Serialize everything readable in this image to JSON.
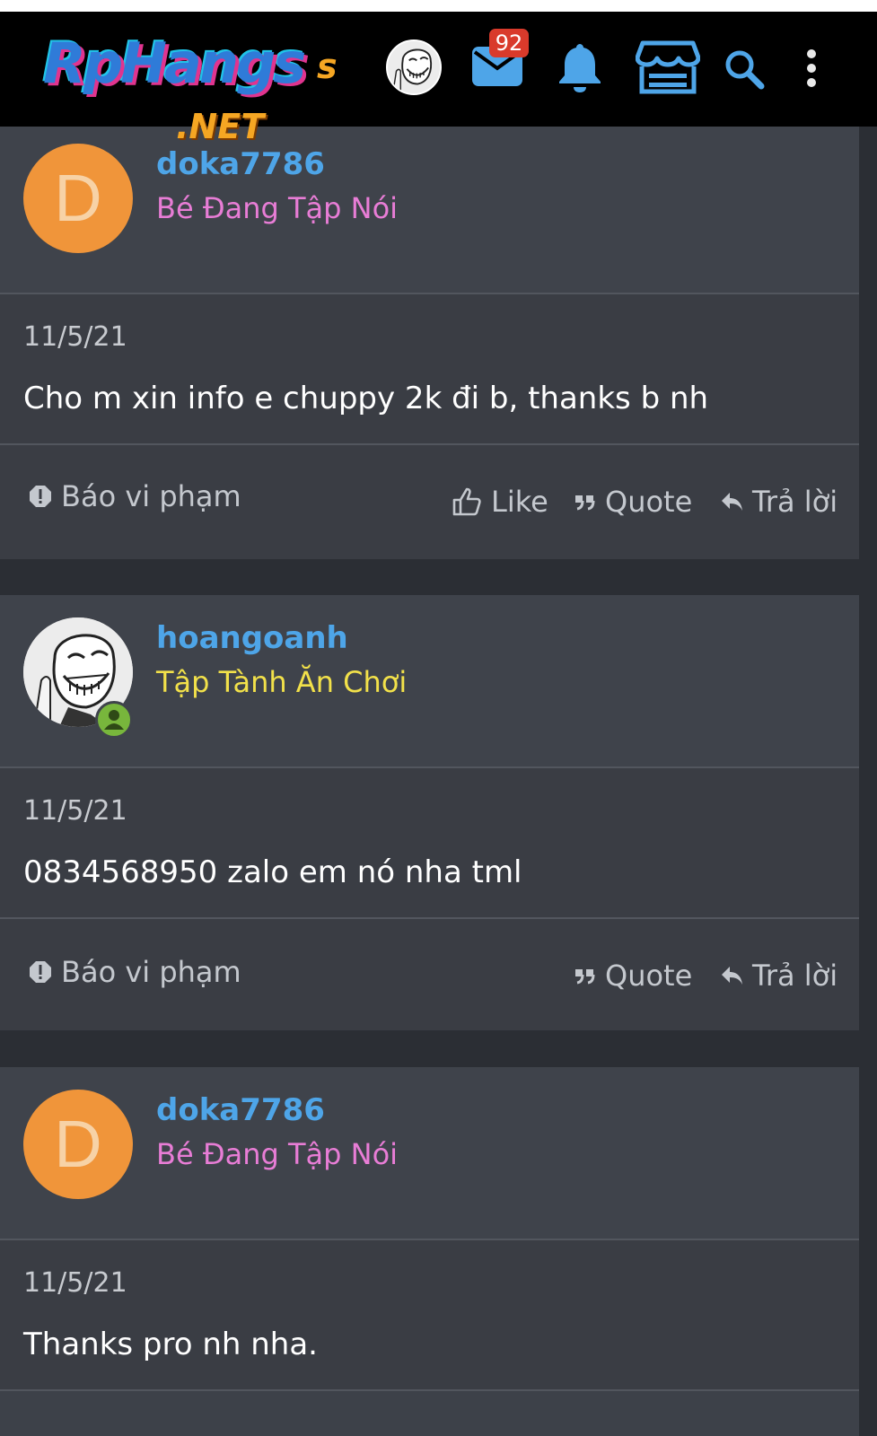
{
  "header": {
    "logo_main": "RpHangs",
    "logo_suffix": "s",
    "logo_net": ".NET",
    "inbox_count": "92",
    "icons": [
      "user-avatar",
      "envelope-icon",
      "bell-icon",
      "store-icon",
      "search-icon",
      "more-vertical-icon"
    ]
  },
  "colors": {
    "accent_blue": "#4ea5e8",
    "title_pink": "#e87dd6",
    "title_yellow": "#f2e14a",
    "avatar_orange": "#f0953a",
    "badge_red": "#d93a2b",
    "online_green": "#78b63c"
  },
  "posts": [
    {
      "avatar_letter": "D",
      "username": "doka7786",
      "user_title": "Bé Đang Tập Nói",
      "date": "11/5/21",
      "message": "Cho m xin info e chuppy 2k đi b, thanks b nh",
      "report": "Báo vi phạm",
      "like": "Like",
      "quote": "Quote",
      "reply": "Trả lời"
    },
    {
      "username": "hoangoanh",
      "user_title": "Tập Tành Ăn Chơi",
      "date": "11/5/21",
      "message": "0834568950 zalo em nó nha tml",
      "report": "Báo vi phạm",
      "quote": "Quote",
      "reply": "Trả lời"
    },
    {
      "avatar_letter": "D",
      "username": "doka7786",
      "user_title": "Bé Đang Tập Nói",
      "date": "11/5/21",
      "message": "Thanks pro nh nha."
    }
  ]
}
